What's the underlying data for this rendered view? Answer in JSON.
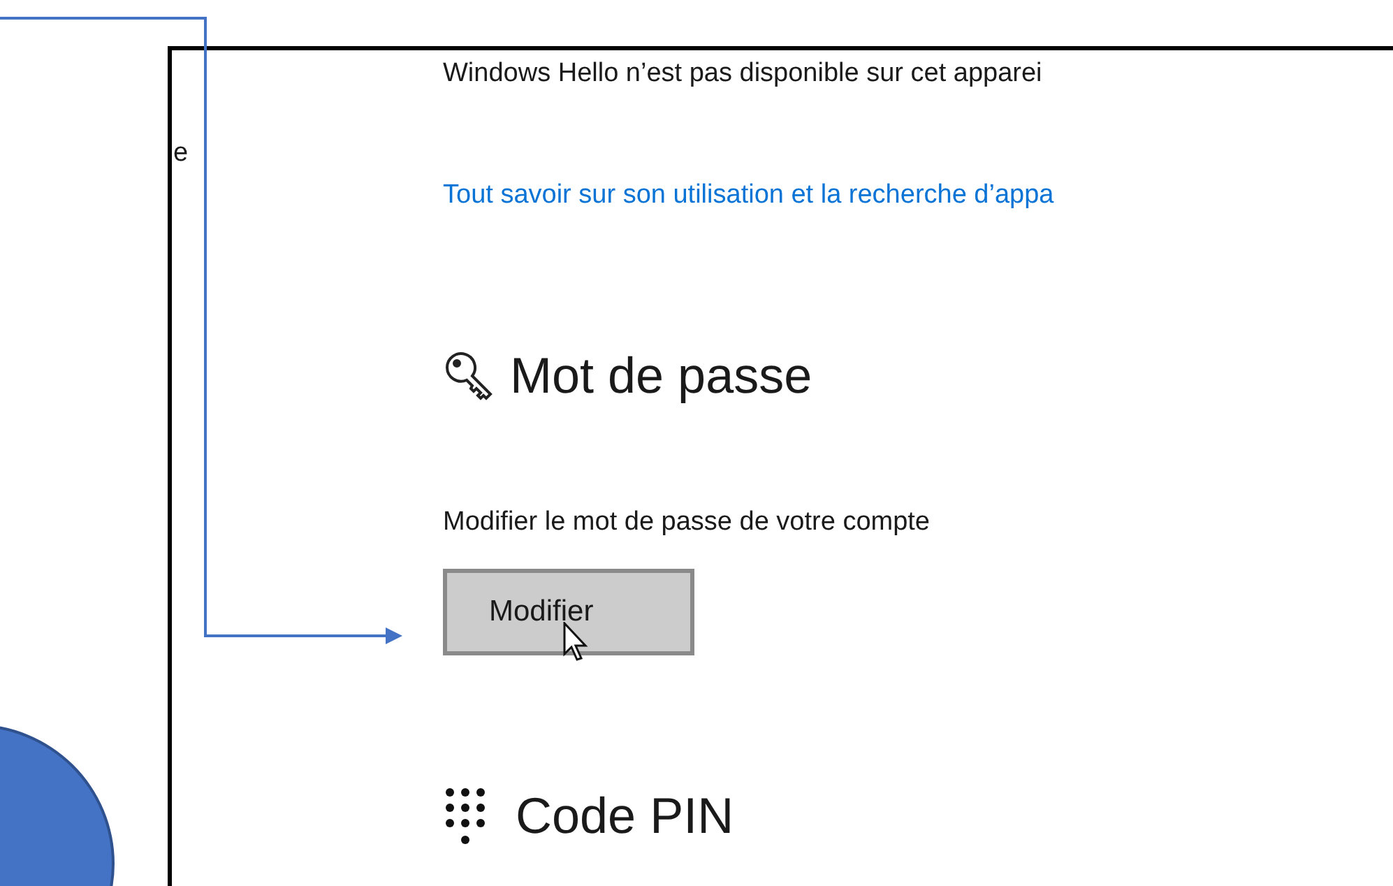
{
  "cut_left_text": "e",
  "hello_notice": "Windows Hello n’est pas disponible sur cet apparei",
  "hello_link": "Tout savoir sur son utilisation et la recherche d’appa",
  "password_section": {
    "title": "Mot de passe",
    "description": "Modifier le mot de passe de votre compte",
    "button": "Modifier"
  },
  "pin_section": {
    "title": "Code PIN"
  }
}
